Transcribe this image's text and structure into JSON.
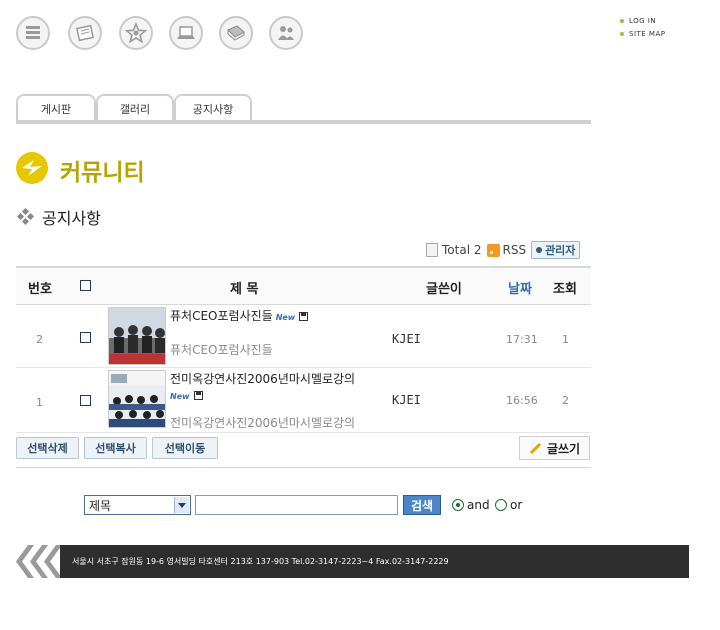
{
  "top_nav": {
    "icons": [
      "list-icon",
      "document-icon",
      "gear-star-icon",
      "laptop-icon",
      "book-icon",
      "people-icon"
    ]
  },
  "util_links": {
    "login": "LOG IN",
    "sitemap": "SITE MAP"
  },
  "tabs": [
    {
      "label": "게시판"
    },
    {
      "label": "갤러리"
    },
    {
      "label": "공지사항"
    }
  ],
  "page": {
    "title": "커뮤니티",
    "subtitle": "공지사항"
  },
  "board": {
    "total_label": "Total 2",
    "rss_label": "RSS",
    "admin_label": "관리자",
    "columns": {
      "no": "번호",
      "title": "제  목",
      "writer": "글쓴이",
      "date": "날짜",
      "views": "조회"
    },
    "rows": [
      {
        "no": "2",
        "title": "퓨처CEO포럼사진들",
        "new_badge": "New",
        "preview": "퓨처CEO포럼사진들",
        "writer": "KJEI",
        "date": "17:31",
        "views": "1"
      },
      {
        "no": "1",
        "title": "전미옥강연사진2006년마시멜로강의",
        "new_badge": "New",
        "preview": "전미옥강연사진2006년마시멜로강의",
        "writer": "KJEI",
        "date": "16:56",
        "views": "2"
      }
    ],
    "actions": {
      "delete": "선택삭제",
      "copy": "선택복사",
      "move": "선택이동",
      "write": "글쓰기"
    }
  },
  "search": {
    "field_selected": "제목",
    "query": "",
    "button": "검색",
    "op_and": "and",
    "op_or": "or",
    "selected_op": "and"
  },
  "footer": {
    "address": "서울시 서초구 잠원동 19-6 영서빌딩 타호센터 213호 137-903 Tel.02-3147-2223~4 Fax.02-3147-2229"
  },
  "colors": {
    "accent": "#b7a400",
    "logo": "#e6c800",
    "footer_bg": "#2e2e2e",
    "link_blue": "#2f5d8a"
  }
}
